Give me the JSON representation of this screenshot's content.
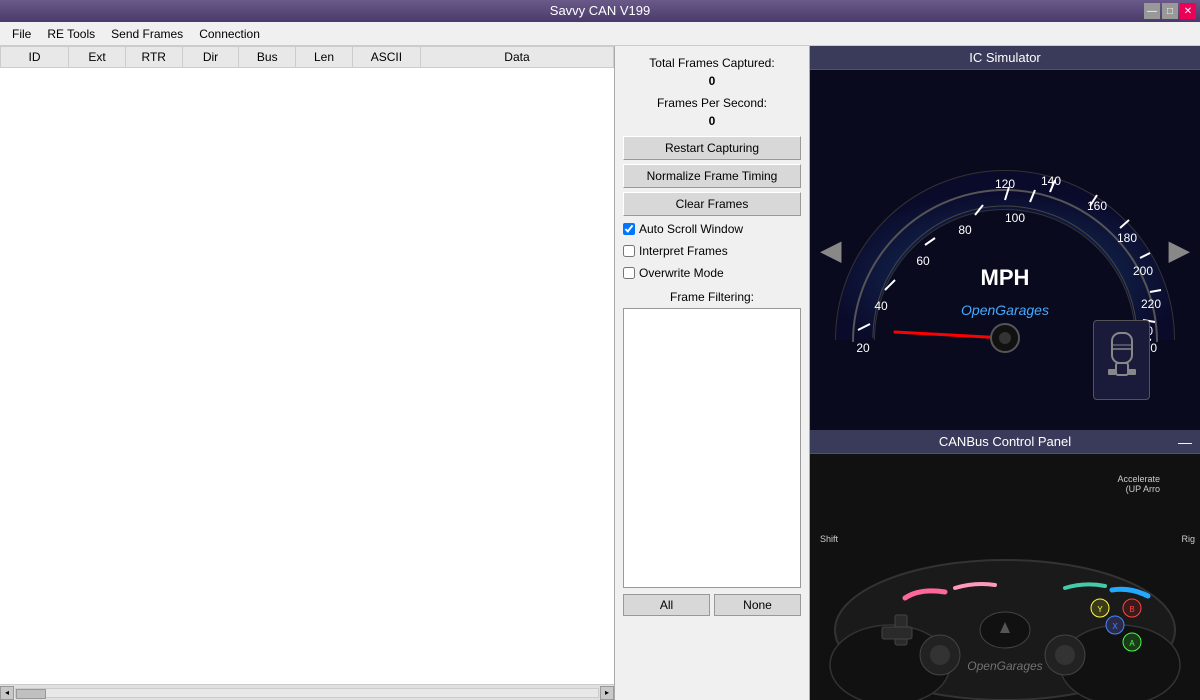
{
  "titlebar": {
    "title": "Savvy CAN V199",
    "minimize_label": "—",
    "maximize_label": "□",
    "close_label": "✕"
  },
  "menubar": {
    "items": [
      "File",
      "RE Tools",
      "Send Frames",
      "Connection"
    ]
  },
  "table": {
    "columns": [
      "ID",
      "Ext",
      "RTR",
      "Dir",
      "Bus",
      "Len",
      "ASCII",
      "Data"
    ],
    "rows": []
  },
  "controls": {
    "total_frames_label": "Total Frames Captured:",
    "total_frames_value": "0",
    "fps_label": "Frames Per Second:",
    "fps_value": "0",
    "restart_btn": "Restart Capturing",
    "normalize_btn": "Normalize Frame Timing",
    "clear_btn": "Clear Frames",
    "auto_scroll_label": "Auto Scroll Window",
    "auto_scroll_checked": true,
    "interpret_frames_label": "Interpret Frames",
    "interpret_frames_checked": false,
    "overwrite_mode_label": "Overwrite Mode",
    "overwrite_mode_checked": false,
    "filter_label": "Frame Filtering:",
    "filter_all_btn": "All",
    "filter_none_btn": "None"
  },
  "ic_simulator": {
    "title": "IC Simulator",
    "nav_left": "◀",
    "nav_right": "▶",
    "unit": "MPH",
    "brand": "OpenGarages",
    "speed_marks": [
      "20",
      "40",
      "60",
      "80",
      "100",
      "120",
      "140",
      "160",
      "180",
      "200",
      "220",
      "240",
      "260"
    ],
    "gear_icon": "gear"
  },
  "canbus": {
    "title": "CANBus Control Panel",
    "minimize": "—",
    "labels": {
      "accelerate": "Accelerate",
      "accelerate_sub": "(UP Arro",
      "shift": "Shift",
      "right": "Rig"
    },
    "og_text": "OpenGarages"
  },
  "icons": {
    "left_arrow": "◀",
    "right_arrow": "▶",
    "check": "✓"
  }
}
